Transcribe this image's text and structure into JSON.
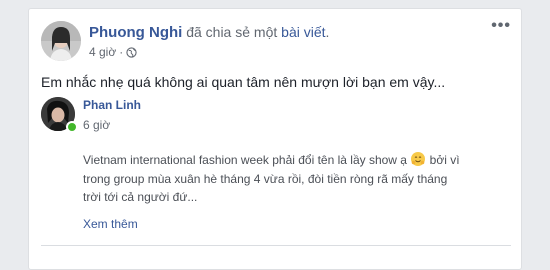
{
  "post": {
    "author": "Phuong Nghi",
    "action_text": "đã chia sẻ một",
    "action_link": "bài viết",
    "action_end": ".",
    "time": "4 giờ",
    "separator": "·",
    "privacy_icon": "globe-icon",
    "more_icon": "•••",
    "text": "Em nhắc nhẹ quá không ai quan tâm nên mượn lời bạn em vậy..."
  },
  "shared_post": {
    "author": "Phan Linh",
    "time": "6 giờ",
    "body_part1": "Vietnam international fashion week phải đổi tên là lầy show ạ",
    "emoji": "hugging-face-emoji",
    "body_part2": " bởi vì trong group mùa xuân hè tháng 4 vừa rồi, đòi tiền ròng rã mấy tháng trời tới cả người đứ...",
    "see_more": "Xem thêm"
  },
  "colors": {
    "link": "#385898",
    "meta": "#616770",
    "online": "#42b72a",
    "background": "#e9ebee"
  }
}
